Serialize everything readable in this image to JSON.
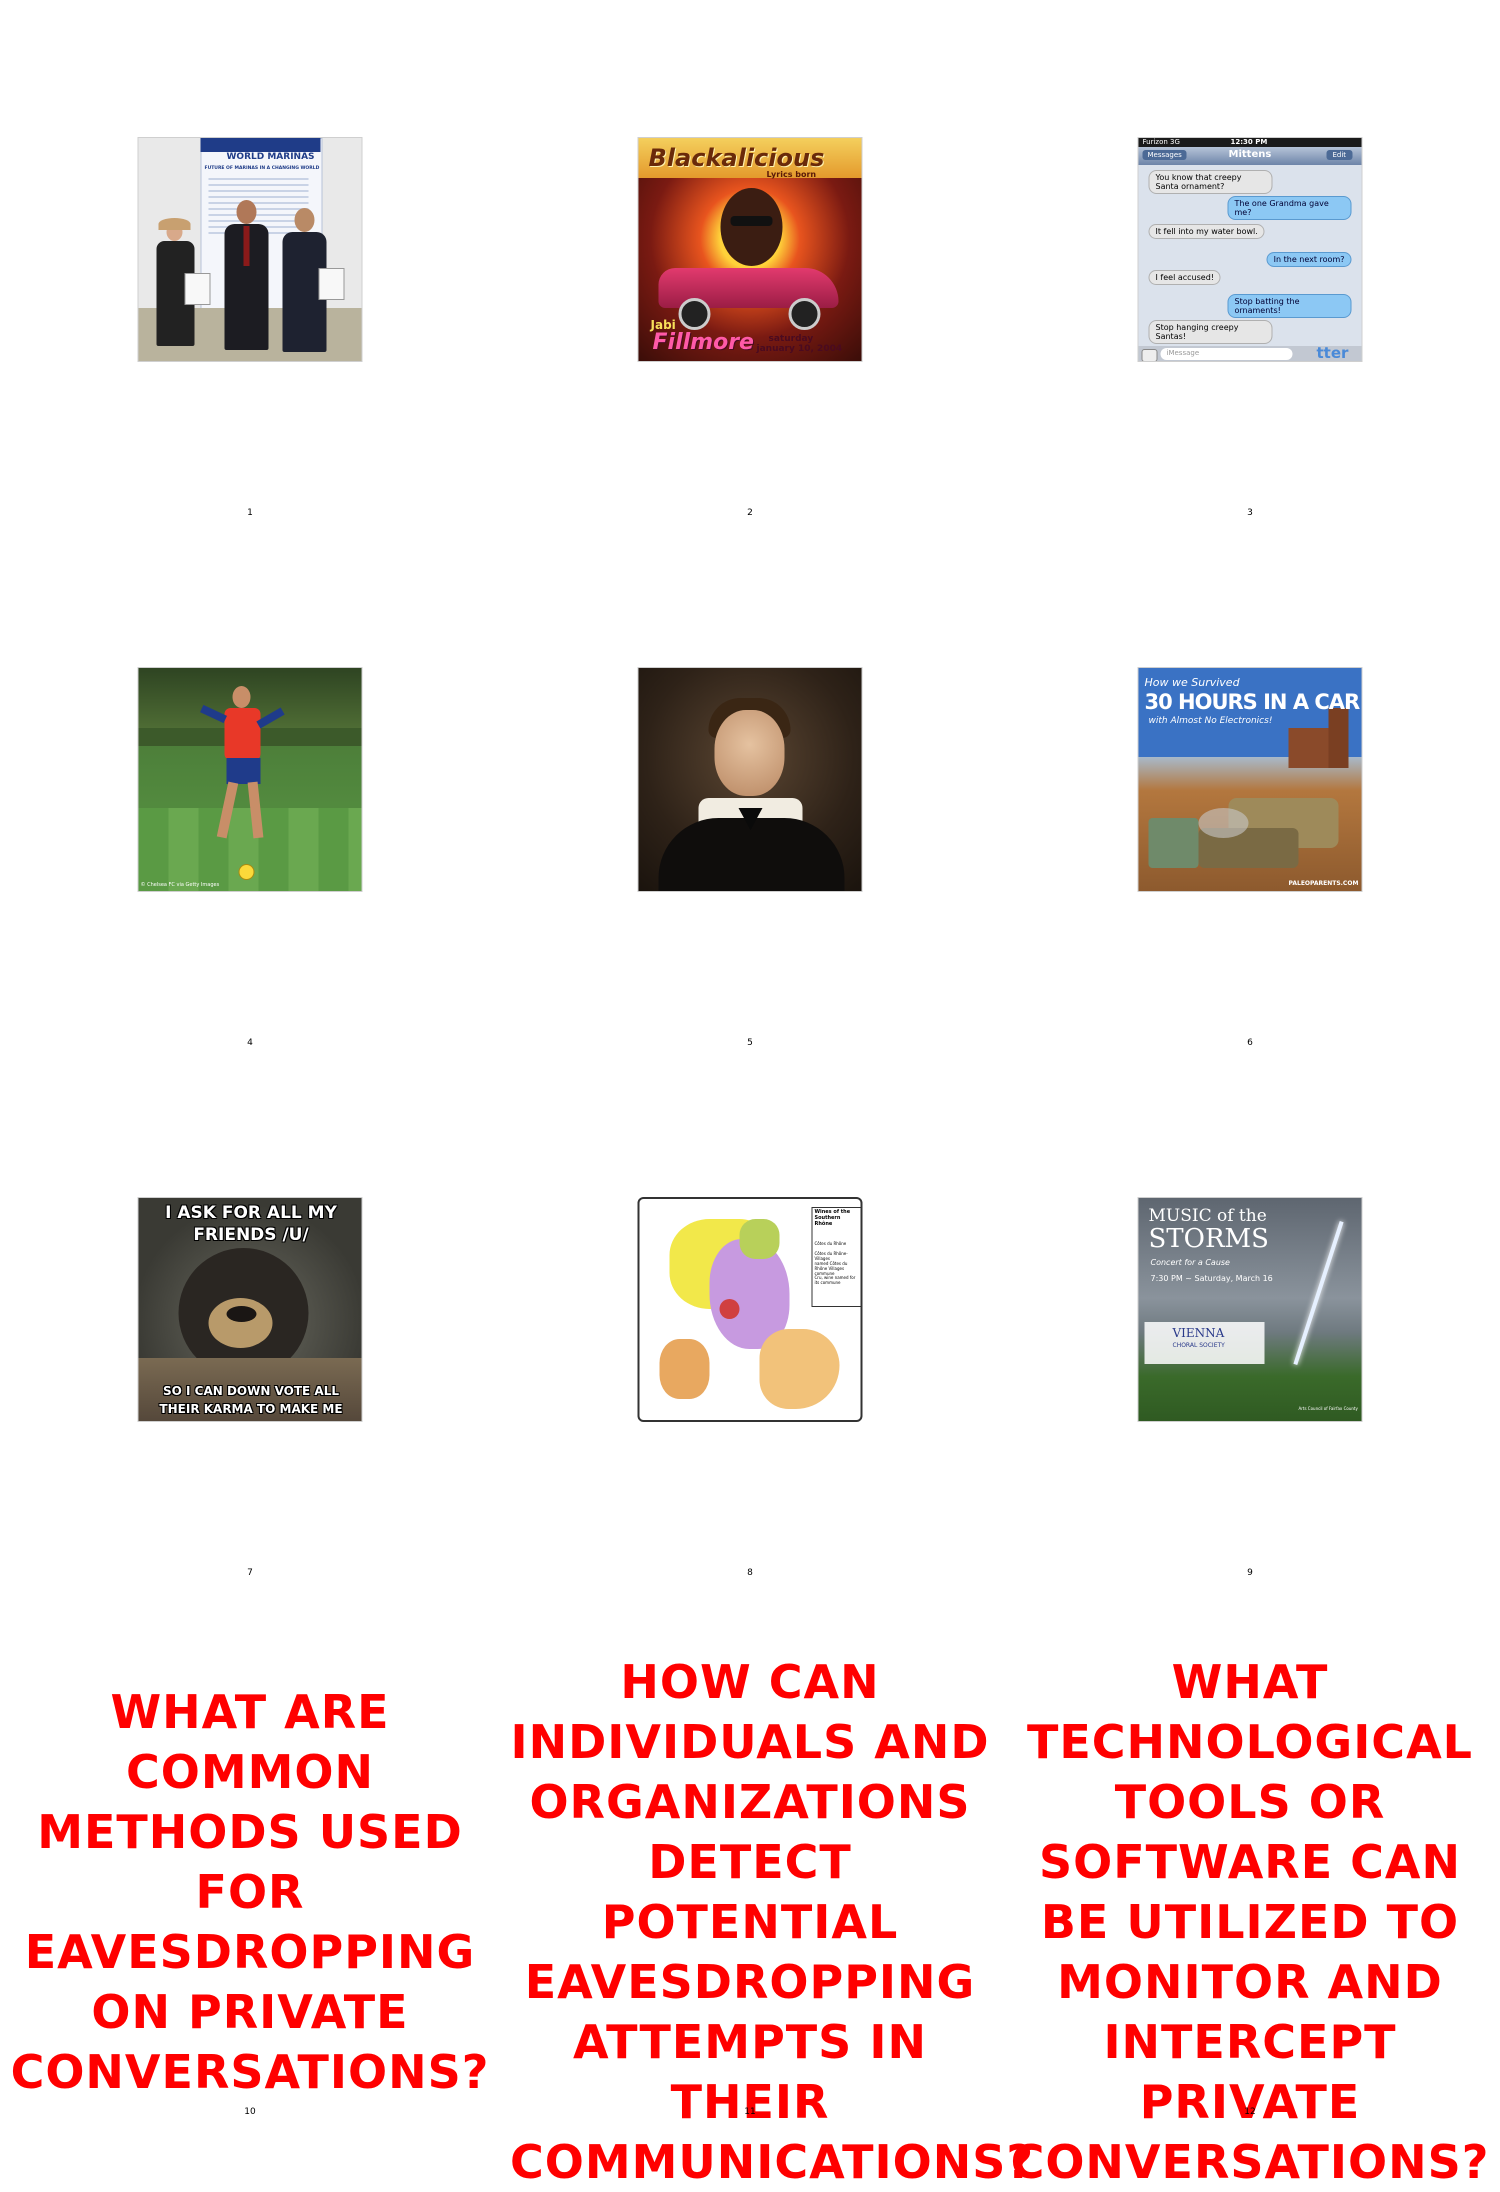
{
  "cells": [
    {
      "number": "1",
      "poster_lines": [
        "WORLD MARINAS",
        "FUTURE OF MARINAS IN A CHANGING WORLD"
      ]
    },
    {
      "number": "2",
      "title": "Blackalicious",
      "subtitle": "Lyrics born",
      "venue": "Fillmore",
      "date_line1": "saturday",
      "date_line2": "january 10, 2004",
      "guest": "Jabi"
    },
    {
      "number": "3",
      "status_carrier": "Furizon 3G",
      "status_time": "12:30 PM",
      "nav_back": "Messages",
      "nav_title": "Mittens",
      "nav_edit": "Edit",
      "messages": [
        {
          "side": "left",
          "text": "You know that creepy Santa ornament?"
        },
        {
          "side": "right",
          "text": "The one Grandma gave me?"
        },
        {
          "side": "left",
          "text": "It fell into my water bowl."
        },
        {
          "side": "right",
          "text": "In the next room?"
        },
        {
          "side": "left",
          "text": "I feel accused!"
        },
        {
          "side": "right",
          "text": "Stop batting the ornaments!"
        },
        {
          "side": "left",
          "text": "Stop hanging creepy Santas!"
        }
      ],
      "input_placeholder": "iMessage",
      "watermark": "tter"
    },
    {
      "number": "4",
      "credit": "© Chelsea FC via Getty Images"
    },
    {
      "number": "5"
    },
    {
      "number": "6",
      "line1": "How we Survived",
      "line2": "30 HOURS IN A CAR",
      "line3": "with Almost No Electronics!",
      "site": "PALEOPARENTS.COM"
    },
    {
      "number": "7",
      "top_text": "I ASK FOR ALL MY FRIENDS /U/",
      "bottom_text": "SO I CAN DOWN VOTE ALL THEIR KARMA TO MAKE ME FEEL BETTER"
    },
    {
      "number": "8",
      "legend_title": "Wines of the Southern Rhône",
      "legend_items": [
        "Côtes du Rhône",
        "Côtes du Rhône-Villages",
        "named Côtes du Rhône Villages commune",
        "Cru, wine named for its commune"
      ]
    },
    {
      "number": "9",
      "title1": "MUSIC of the",
      "title2": "STORMS",
      "tagline": "Concert for a Cause",
      "time_line": "7:30 PM ~ Saturday, March 16",
      "org": "VIENNA",
      "org_sub": "CHORAL SOCIETY",
      "sponsor": "Arts Council of Fairfax County"
    },
    {
      "number": "10",
      "question": "WHAT ARE COMMON METHODS USED FOR EAVESDROPPING ON PRIVATE CONVERSATIONS?"
    },
    {
      "number": "11",
      "question": "HOW CAN INDIVIDUALS AND ORGANIZATIONS DETECT POTENTIAL EAVESDROPPING ATTEMPTS IN THEIR COMMUNICATIONS?"
    },
    {
      "number": "12",
      "question": "WHAT TECHNOLOGICAL TOOLS OR SOFTWARE CAN BE UTILIZED TO MONITOR AND INTERCEPT PRIVATE CONVERSATIONS?"
    }
  ],
  "colors": {
    "question_text": "#ff0000",
    "background": "#ffffff"
  }
}
